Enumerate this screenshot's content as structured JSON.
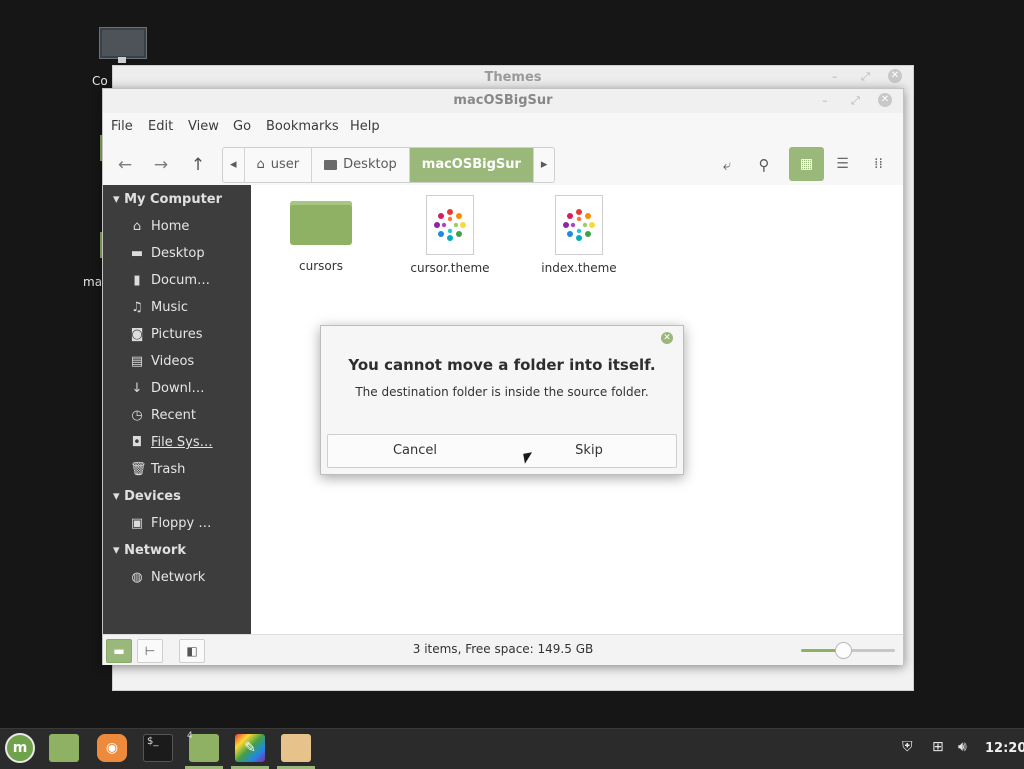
{
  "desktop": {
    "icons": [
      {
        "label": "Co"
      },
      {
        "label": "ma"
      }
    ]
  },
  "themes_window": {
    "title": "Themes"
  },
  "file_manager": {
    "title": "macOSBigSur",
    "menu": [
      "File",
      "Edit",
      "View",
      "Go",
      "Bookmarks",
      "Help"
    ],
    "breadcrumbs": [
      "user",
      "Desktop",
      "macOSBigSur"
    ],
    "sidebar": {
      "my_computer": {
        "heading": "My Computer",
        "items": [
          "Home",
          "Desktop",
          "Docum…",
          "Music",
          "Pictures",
          "Videos",
          "Downl…",
          "Recent",
          "File Sys…",
          "Trash"
        ]
      },
      "devices": {
        "heading": "Devices",
        "items": [
          "Floppy …"
        ]
      },
      "network": {
        "heading": "Network",
        "items": [
          "Network"
        ]
      }
    },
    "files": [
      {
        "name": "cursors",
        "kind": "folder"
      },
      {
        "name": "cursor.theme",
        "kind": "theme"
      },
      {
        "name": "index.theme",
        "kind": "theme"
      }
    ],
    "status": "3 items, Free space: 149.5 GB",
    "zoom_level": 0.45
  },
  "dialog": {
    "title": "You cannot move a folder into itself.",
    "message": "The destination folder is inside the source folder.",
    "cancel_label": "Cancel",
    "skip_label": "Skip"
  },
  "taskbar": {
    "workspace_badge": "4",
    "terminal_glyph": "$_",
    "clock": "12:20"
  },
  "colors": {
    "accent": "#9ab87a",
    "folder": "#8fb163",
    "sidebar_bg": "#3d3d3d",
    "taskbar_bg": "#2b2b2b"
  }
}
